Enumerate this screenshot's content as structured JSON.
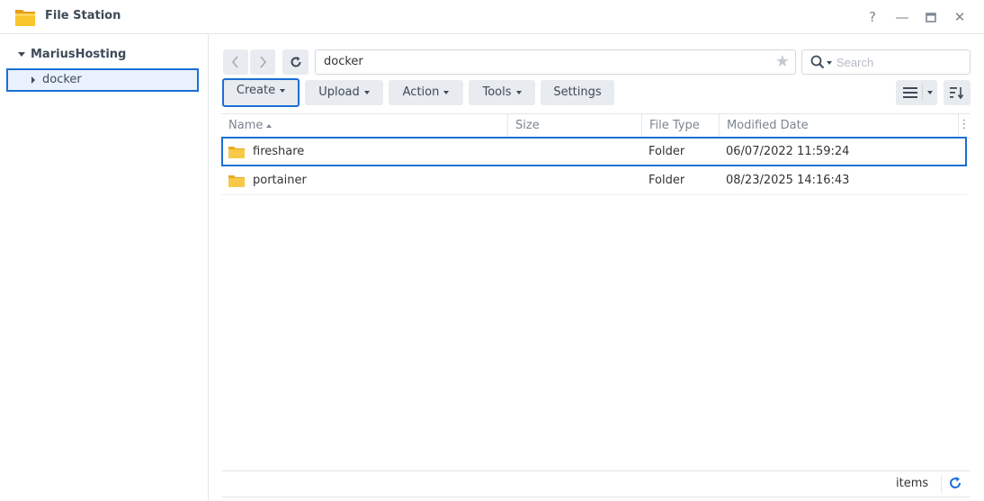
{
  "window": {
    "title": "File Station",
    "controls": {
      "help": "?",
      "minimize": "—",
      "maximize": "□",
      "close": "✕"
    }
  },
  "tree": {
    "root_label": "MariusHosting",
    "items": [
      {
        "label": "docker"
      }
    ]
  },
  "toolbar": {
    "path": "docker",
    "search_placeholder": "Search",
    "buttons": [
      {
        "label": "Create"
      },
      {
        "label": "Upload"
      },
      {
        "label": "Action"
      },
      {
        "label": "Tools"
      },
      {
        "label": "Settings"
      }
    ]
  },
  "table": {
    "columns": [
      {
        "label": "Name"
      },
      {
        "label": "Size"
      },
      {
        "label": "File Type"
      },
      {
        "label": "Modified Date"
      }
    ],
    "rows": [
      {
        "name": "fireshare",
        "size": "",
        "type": "Folder",
        "modified": "06/07/2022 11:59:24"
      },
      {
        "name": "portainer",
        "size": "",
        "type": "Folder",
        "modified": "08/23/2025 14:16:43"
      }
    ]
  },
  "footer": {
    "items_label": "items"
  },
  "colors": {
    "accent": "#1c6fd6",
    "folder": "#f5c342",
    "button_bg": "#e8ebef"
  }
}
